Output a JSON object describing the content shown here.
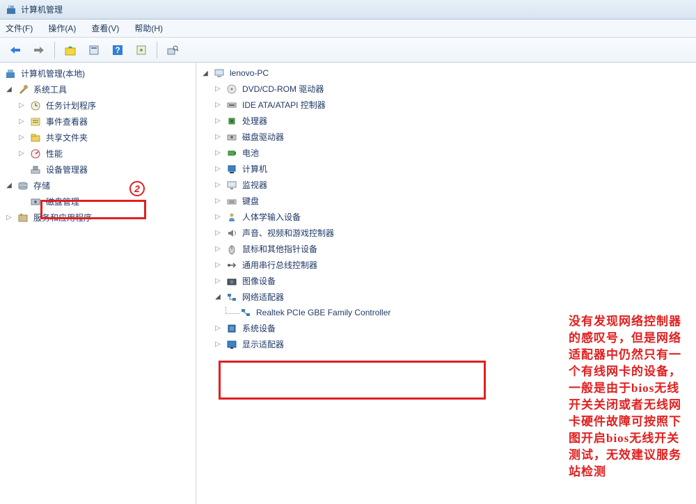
{
  "titlebar": {
    "title": "计算机管理"
  },
  "menu": {
    "file": "文件(F)",
    "action": "操作(A)",
    "view": "查看(V)",
    "help": "帮助(H)"
  },
  "leftTree": {
    "root": "计算机管理(本地)",
    "systemTools": "系统工具",
    "taskScheduler": "任务计划程序",
    "eventViewer": "事件查看器",
    "sharedFolders": "共享文件夹",
    "performance": "性能",
    "deviceManager": "设备管理器",
    "storage": "存储",
    "diskManagement": "磁盘管理",
    "services": "服务和应用程序"
  },
  "rightTree": {
    "pc": "lenovo-PC",
    "dvd": "DVD/CD-ROM 驱动器",
    "ide": "IDE ATA/ATAPI 控制器",
    "cpu": "处理器",
    "diskDrives": "磁盘驱动器",
    "battery": "电池",
    "computer": "计算机",
    "monitor": "监视器",
    "keyboard": "键盘",
    "hid": "人体学输入设备",
    "sound": "声音、视频和游戏控制器",
    "mouse": "鼠标和其他指针设备",
    "usb": "通用串行总线控制器",
    "imaging": "图像设备",
    "network": "网络适配器",
    "networkCard": "Realtek PCIe GBE Family Controller",
    "systemDevices": "系统设备",
    "display": "显示适配器"
  },
  "annotation": {
    "text": "没有发现网络控制器的感叹号，但是网络适配器中仍然只有一个有线网卡的设备，一般是由于bios无线开关关闭或者无线网卡硬件故障可按照下图开启bios无线开关测试，无效建议服务站检测",
    "circleNumber": "2"
  }
}
